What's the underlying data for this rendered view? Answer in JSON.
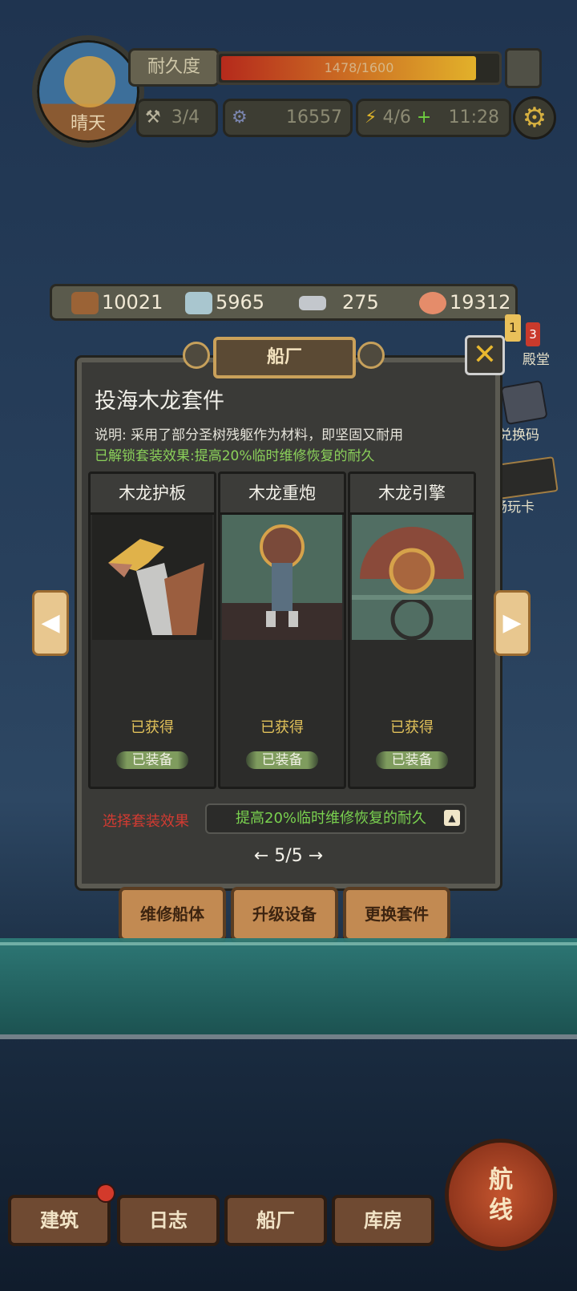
{
  "hud": {
    "weather": "晴天",
    "durability_label": "耐久度",
    "durability_text": "1478/1600",
    "durability_fraction": 0.924,
    "builders": "3/4",
    "gears": "16557",
    "energy": "4/6",
    "timer": "11:28"
  },
  "resources": [
    {
      "icon": "wood-log-icon",
      "value": "10021"
    },
    {
      "icon": "stone-icon",
      "value": "5965"
    },
    {
      "icon": "iron-ingot-icon",
      "value": "275"
    },
    {
      "icon": "meat-icon",
      "value": "19312"
    }
  ],
  "panel": {
    "title": "船厂",
    "set_name": "投海木龙套件",
    "description": "说明: 采用了部分圣树残躯作为材料，即坚固又耐用",
    "unlocked_bonus": "已解锁套装效果:提高20%临时维修恢复的耐久",
    "cards": [
      {
        "name": "木龙护板",
        "status": "已获得",
        "equip": "已装备"
      },
      {
        "name": "木龙重炮",
        "status": "已获得",
        "equip": "已装备"
      },
      {
        "name": "木龙引擎",
        "status": "已获得",
        "equip": "已装备"
      }
    ],
    "select_label": "选择套装效果",
    "select_value": "提高20%临时维修恢复的耐久",
    "pager": "← 5/5 →",
    "buttons": {
      "repair": "维修船体",
      "upgrade": "升级设备",
      "swap": "更换套件"
    }
  },
  "side": {
    "redeem": "兑换码",
    "pass": "畅玩卡",
    "hall": "殿堂",
    "badge1": "1",
    "badge2": "3"
  },
  "nav": {
    "build": "建筑",
    "log": "日志",
    "shipyard": "船厂",
    "storage": "库房",
    "route": "航线"
  }
}
